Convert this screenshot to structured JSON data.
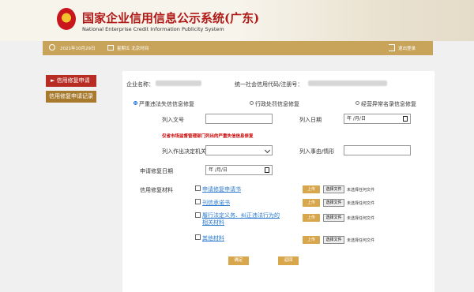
{
  "header": {
    "title_cn": "国家企业信用信息公示系统(广东)",
    "title_en": "National Enterprise Credit Information Publicity System"
  },
  "infobar": {
    "date": "2021年10月29日",
    "timezone": "星期五 北京时间",
    "logout": "退出登录"
  },
  "sidebar": {
    "items": [
      {
        "label": "► 信用修复申请"
      },
      {
        "label": "信用修复申请记录"
      }
    ]
  },
  "company": {
    "name_label": "企业名称：",
    "code_label": "统一社会信用代码/注册号："
  },
  "repair_types": [
    {
      "label": "严重违法失信信息修复",
      "selected": true
    },
    {
      "label": "行政处罚信息修复",
      "selected": false
    },
    {
      "label": "经营异常名录信息修复",
      "selected": false
    }
  ],
  "form": {
    "doc_no_label": "列入文号",
    "date_in_label": "列入日期",
    "date_placeholder": "年 /月/日",
    "notice": "仅省市场监督管理部门列出的严重失信信息修复",
    "authority_label": "列入作出决定机关",
    "reason_label": "列入事由/情形",
    "repair_date_label": "申请修复日期",
    "materials_label": "信用修复材料"
  },
  "materials": [
    {
      "name": "申请修复申请书",
      "upload": "上传",
      "choose": "选择文件",
      "status": "未选择任何文件"
    },
    {
      "name": "刊信承诺书",
      "upload": "上传",
      "choose": "选择文件",
      "status": "未选择任何文件"
    },
    {
      "name": "履行法定义务、纠正违法行为的相关材料",
      "upload": "上传",
      "choose": "选择文件",
      "status": "未选择任何文件"
    },
    {
      "name": "其他材料",
      "upload": "上传",
      "choose": "选择文件",
      "status": "未选择任何文件"
    }
  ],
  "actions": {
    "confirm": "确定",
    "back": "返回"
  }
}
